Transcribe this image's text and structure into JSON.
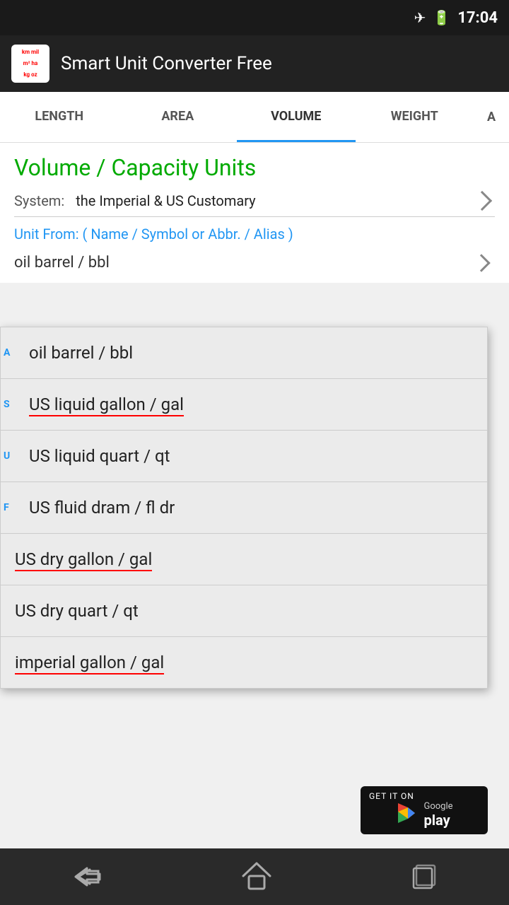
{
  "statusBar": {
    "time": "17:04",
    "icons": [
      "airplane-icon",
      "battery-icon"
    ]
  },
  "appBar": {
    "title": "Smart Unit Converter Free",
    "logoLines": [
      "km mil",
      "m² ha",
      "kg oz"
    ]
  },
  "tabs": [
    {
      "label": "LENGTH",
      "active": false
    },
    {
      "label": "AREA",
      "active": false
    },
    {
      "label": "VOLUME",
      "active": true
    },
    {
      "label": "WEIGHT",
      "active": false
    },
    {
      "label": "A",
      "active": false
    }
  ],
  "content": {
    "heading": "Volume / Capacity Units",
    "systemLabel": "System:",
    "systemValue": "the Imperial & US Customary",
    "unitFromLabel": "Unit From: ( Name / Symbol or Abbr. / Alias )",
    "selectedUnit": "oil barrel / bbl"
  },
  "dropdown": {
    "items": [
      {
        "text": "oil barrel / bbl",
        "underline": false,
        "leftMarker": "A"
      },
      {
        "text": "US liquid gallon / gal",
        "underline": true,
        "leftMarker": "S"
      },
      {
        "text": "US liquid quart / qt",
        "underline": false,
        "leftMarker": "U"
      },
      {
        "text": "US fluid dram / fl dr",
        "underline": false,
        "leftMarker": "F"
      },
      {
        "text": "US dry gallon / gal",
        "underline": true,
        "leftMarker": ""
      },
      {
        "text": "US dry quart / qt",
        "underline": false,
        "leftMarker": ""
      },
      {
        "text": "imperial gallon / gal",
        "underline": true,
        "leftMarker": ""
      }
    ]
  },
  "googlePlay": {
    "topText": "GET IT ON",
    "brandText": "Google play",
    "iconColor": "#4CAF50"
  },
  "navBar": {
    "buttons": [
      "back-button",
      "home-button",
      "recents-button"
    ]
  }
}
